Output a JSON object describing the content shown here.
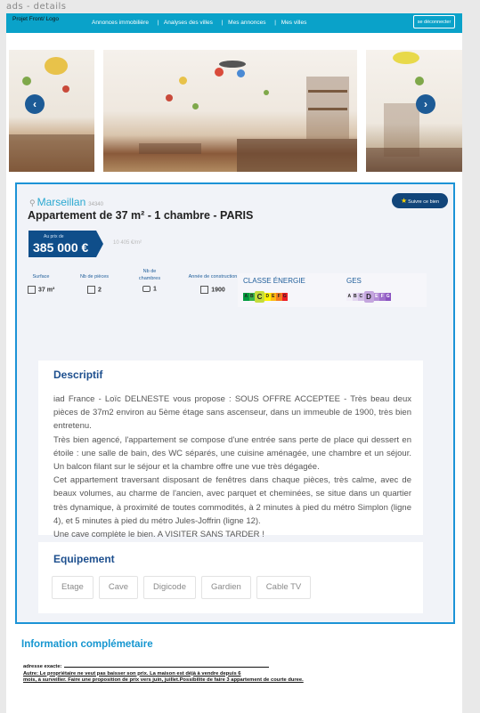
{
  "window": {
    "title": "ads - details"
  },
  "navbar": {
    "logo": "Projet Front/ Logo",
    "links": [
      "Annonces immobilière",
      "Analyses des villes",
      "Mes annonces",
      "Mes villes"
    ],
    "logout_label": "se déconnecter",
    "color": "#0aa2c9"
  },
  "gallery": {
    "prev_icon": "chevron-left-icon",
    "next_icon": "chevron-right-icon",
    "prev_glyph": "‹",
    "next_glyph": "›"
  },
  "listing": {
    "city": "Marseillan",
    "zip": "34340",
    "title": "Appartement de 37 m² - 1 chambre - PARIS",
    "follow_label": "Suivre ce bien",
    "price_label": "Au prix de",
    "price": "385 000 €",
    "price_per_m2": "10 405 €/m²",
    "features": [
      {
        "label": "Surface",
        "value": "37 m²",
        "icon": "surface-icon"
      },
      {
        "label": "Nb de pièces",
        "value": "2",
        "icon": "rooms-icon"
      },
      {
        "label": "Nb de chambres",
        "value": "1",
        "icon": "bed-icon"
      },
      {
        "label": "Année de construction",
        "value": "1900",
        "icon": "calendar-icon"
      }
    ],
    "energy": {
      "title": "CLASSE ÉNERGIE",
      "classes": [
        "A",
        "B",
        "C",
        "D",
        "E",
        "F",
        "G"
      ],
      "active": "C"
    },
    "ges": {
      "title": "GES",
      "classes": [
        "A",
        "B",
        "C",
        "D",
        "E",
        "F",
        "G"
      ],
      "active": "D"
    }
  },
  "description": {
    "title": "Descriptif",
    "paragraphs": [
      "iad France - Loïc DELNESTE vous propose : SOUS OFFRE ACCEPTEE - Très beau deux pièces de 37m2 environ au 5ème étage sans ascenseur, dans un immeuble de 1900, très bien entretenu.",
      "Très bien agencé, l'appartement se compose d'une entrée sans perte de place qui dessert en étoile : une salle de bain, des WC séparés, une cuisine aménagée, une chambre et un séjour. Un balcon filant sur le séjour et la chambre offre une vue très dégagée.",
      "Cet appartement traversant disposant de fenêtres dans chaque pièces, très calme, avec de beaux volumes, au charme de l'ancien, avec parquet et cheminées, se situe dans un quartier très dynamique, à proximité de toutes commodités, à 2 minutes à pied du métro Simplon (ligne 4), et 5 minutes à pied du métro Jules-Joffrin (ligne 12).",
      "Une cave complète le bien. A VISITER SANS TARDER !"
    ]
  },
  "equipment": {
    "title": "Equipement",
    "items": [
      "Etage",
      "Cave",
      "Digicode",
      "Gardien",
      "Cable TV"
    ]
  },
  "info": {
    "title": "Information complémetaire",
    "address_label": "adresse exacte:",
    "other_line_1": "Autre: Le propriétaire ne veut pas baisser son prix. La maison est déjà à vendre depuis 6",
    "other_line_2": "mois, à surveiller. Faire une proposition de prix vers juin, juillet.Possibilite de faire 3 appartement de courte duree."
  },
  "colors": {
    "accent": "#0aa2c9",
    "brand_dark": "#0f4e8a",
    "card_border": "#1c93d6"
  }
}
